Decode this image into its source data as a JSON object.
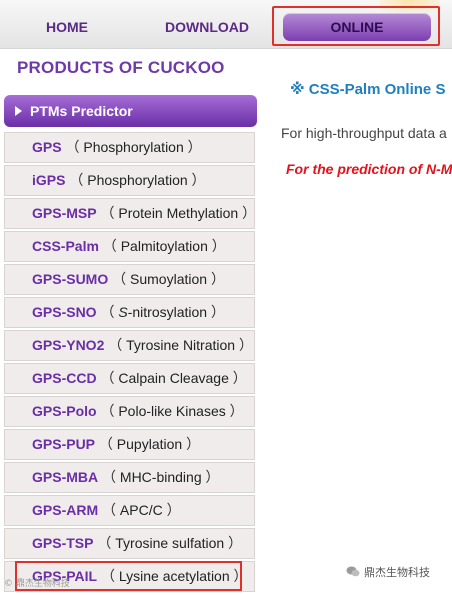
{
  "nav": {
    "home": "HOME",
    "download": "DOWNLOAD",
    "online": "ONLINE"
  },
  "sidebar": {
    "title": "PRODUCTS OF CUCKOO",
    "section_header": "PTMs Predictor",
    "items": [
      {
        "abbr": "GPS",
        "desc": "Phosphorylation"
      },
      {
        "abbr": "iGPS",
        "desc": "Phosphorylation"
      },
      {
        "abbr": "GPS-MSP",
        "desc": "Protein Methylation"
      },
      {
        "abbr": "CSS-Palm",
        "desc": "Palmitoylation"
      },
      {
        "abbr": "GPS-SUMO",
        "desc": "Sumoylation"
      },
      {
        "abbr": "GPS-SNO",
        "desc": "S-nitrosylation"
      },
      {
        "abbr": "GPS-YNO2",
        "desc": "Tyrosine Nitration"
      },
      {
        "abbr": "GPS-CCD",
        "desc": "Calpain Cleavage"
      },
      {
        "abbr": "GPS-Polo",
        "desc": "Polo-like Kinases"
      },
      {
        "abbr": "GPS-PUP",
        "desc": "Pupylation"
      },
      {
        "abbr": "GPS-MBA",
        "desc": "MHC-binding"
      },
      {
        "abbr": "GPS-ARM",
        "desc": "APC/C"
      },
      {
        "abbr": "GPS-TSP",
        "desc": "Tyrosine sulfation"
      },
      {
        "abbr": "GPS-PAIL",
        "desc": "Lysine acetylation"
      }
    ]
  },
  "main": {
    "title": "※ CSS-Palm Online S",
    "intro": "For high-throughput data a",
    "note": "For the prediction of N-M"
  },
  "watermark": {
    "left": "© 鼎杰生物科技",
    "right": "鼎杰生物科技"
  },
  "colors": {
    "accent_purple": "#6a2ea6",
    "highlight_red": "#e0302c",
    "title_blue": "#1f7fc1",
    "note_red": "#e4121b"
  }
}
